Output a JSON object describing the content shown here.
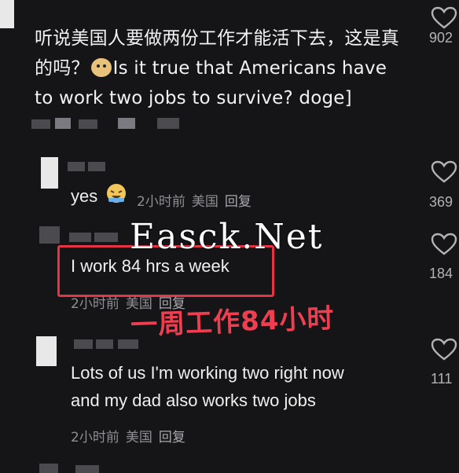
{
  "top_comment": {
    "text_before": "听说美国人要做两份工作才能活下去，这是真的吗？",
    "emoji": "doge",
    "text_after": "Is it true that Americans have to work two jobs to survive? doge]",
    "like_count": "902"
  },
  "replies": [
    {
      "text": "yes",
      "emoji": "laughing-crying",
      "time": "2小时前",
      "location": "美国",
      "reply_label": "回复",
      "like_count": "369"
    },
    {
      "text": "I work 84 hrs a week",
      "time": "2小时前",
      "location": "美国",
      "reply_label": "回复",
      "like_count": "184"
    },
    {
      "text_line1": "Lots of us I'm working two right now",
      "text_line2": "and my dad also works two jobs",
      "time": "2小时前",
      "location": "美国",
      "reply_label": "回复",
      "like_count": "111"
    }
  ],
  "overlay": {
    "watermark": "Easck.Net",
    "handwritten_note": "一周工作84小时"
  },
  "colors": {
    "background": "#151417",
    "highlight_red": "#e53445"
  }
}
